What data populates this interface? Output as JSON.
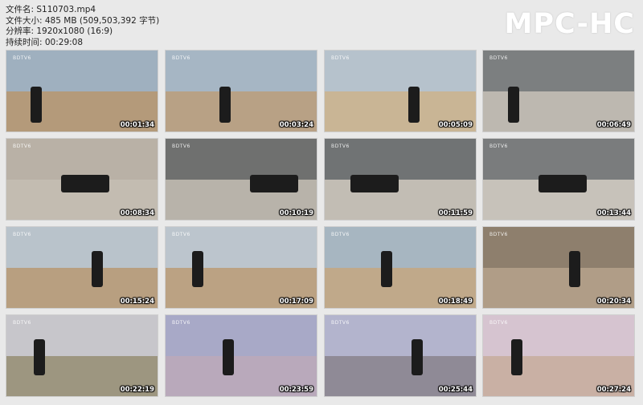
{
  "info": {
    "filename": "文件名: S110703.mp4",
    "filesize": "文件大小: 485 MB (509,503,392 字节)",
    "resolution": "分辨率: 1920x1080 (16:9)",
    "duration": "持续时间: 00:29:08"
  },
  "brand": "MPC-HC",
  "thumbs": [
    {
      "time": "00:01:34",
      "logo": "BDTV6",
      "sky": "#9fb0bf",
      "ground": "#b49a7a"
    },
    {
      "time": "00:03:24",
      "logo": "BDTV6",
      "sky": "#a6b6c4",
      "ground": "#b8a185"
    },
    {
      "time": "00:05:09",
      "logo": "BDTV6",
      "sky": "#b6c2cc",
      "ground": "#c9b595"
    },
    {
      "time": "00:06:49",
      "logo": "BDTV6",
      "sky": "#7c7f80",
      "ground": "#bdb8b0"
    },
    {
      "time": "00:08:34",
      "logo": "BDTV6",
      "sky": "#b9b1a6",
      "ground": "#c3bcb1"
    },
    {
      "time": "00:10:19",
      "logo": "BDTV6",
      "sky": "#6f706f",
      "ground": "#b8b3aa"
    },
    {
      "time": "00:11:59",
      "logo": "BDTV6",
      "sky": "#707374",
      "ground": "#c2bdb4"
    },
    {
      "time": "00:13:44",
      "logo": "BDTV6",
      "sky": "#7a7c7d",
      "ground": "#c7c2ba"
    },
    {
      "time": "00:15:24",
      "logo": "BDTV6",
      "sky": "#b9c3cb",
      "ground": "#b89f80"
    },
    {
      "time": "00:17:09",
      "logo": "BDTV6",
      "sky": "#bcc5cd",
      "ground": "#bba283"
    },
    {
      "time": "00:18:49",
      "logo": "BDTV6",
      "sky": "#a7b6c1",
      "ground": "#c0a98a"
    },
    {
      "time": "00:20:34",
      "logo": "BDTV6",
      "sky": "#8e7f6d",
      "ground": "#b09d87"
    },
    {
      "time": "00:22:19",
      "logo": "BDTV6",
      "sky": "#c7c6cb",
      "ground": "#9d9680"
    },
    {
      "time": "00:23:59",
      "logo": "BDTV6",
      "sky": "#a8a9c7",
      "ground": "#b9a9bb"
    },
    {
      "time": "00:25:44",
      "logo": "BDTV6",
      "sky": "#b3b4cd",
      "ground": "#8f8a96"
    },
    {
      "time": "00:27:24",
      "logo": "BDTV6",
      "sky": "#d6c4d0",
      "ground": "#c9b0a4"
    }
  ]
}
